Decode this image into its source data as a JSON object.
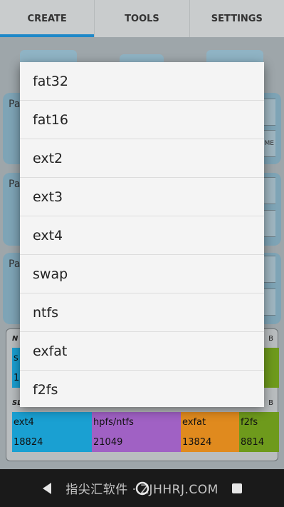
{
  "tabs": [
    {
      "label": "CREATE",
      "active": true
    },
    {
      "label": "TOOLS",
      "active": false
    },
    {
      "label": "SETTINGS",
      "active": false
    }
  ],
  "partition_labels": [
    "Pa",
    "Pa",
    "Pa"
  ],
  "side_button_text": "ME",
  "summary": {
    "top_left": "N",
    "top_right": "B",
    "top_segment_partial": {
      "name": "s",
      "size": "1"
    },
    "mid_left": "SL",
    "mid_right": "B",
    "segments": [
      {
        "name": "ext4",
        "size": "18824",
        "color": "#1aa0d2"
      },
      {
        "name": "hpfs/ntfs",
        "size": "21049",
        "color": "#a061c4"
      },
      {
        "name": "exfat",
        "size": "13824",
        "color": "#e08a1e"
      },
      {
        "name": "f2fs",
        "size": "8814",
        "color": "#6e9a1c"
      }
    ]
  },
  "dropdown_options": [
    "fat32",
    "fat16",
    "ext2",
    "ext3",
    "ext4",
    "swap",
    "ntfs",
    "exfat",
    "f2fs"
  ],
  "watermark": "指尖汇软件 · ZJHHRJ.COM",
  "colors": {
    "accent": "#1e88c8"
  }
}
